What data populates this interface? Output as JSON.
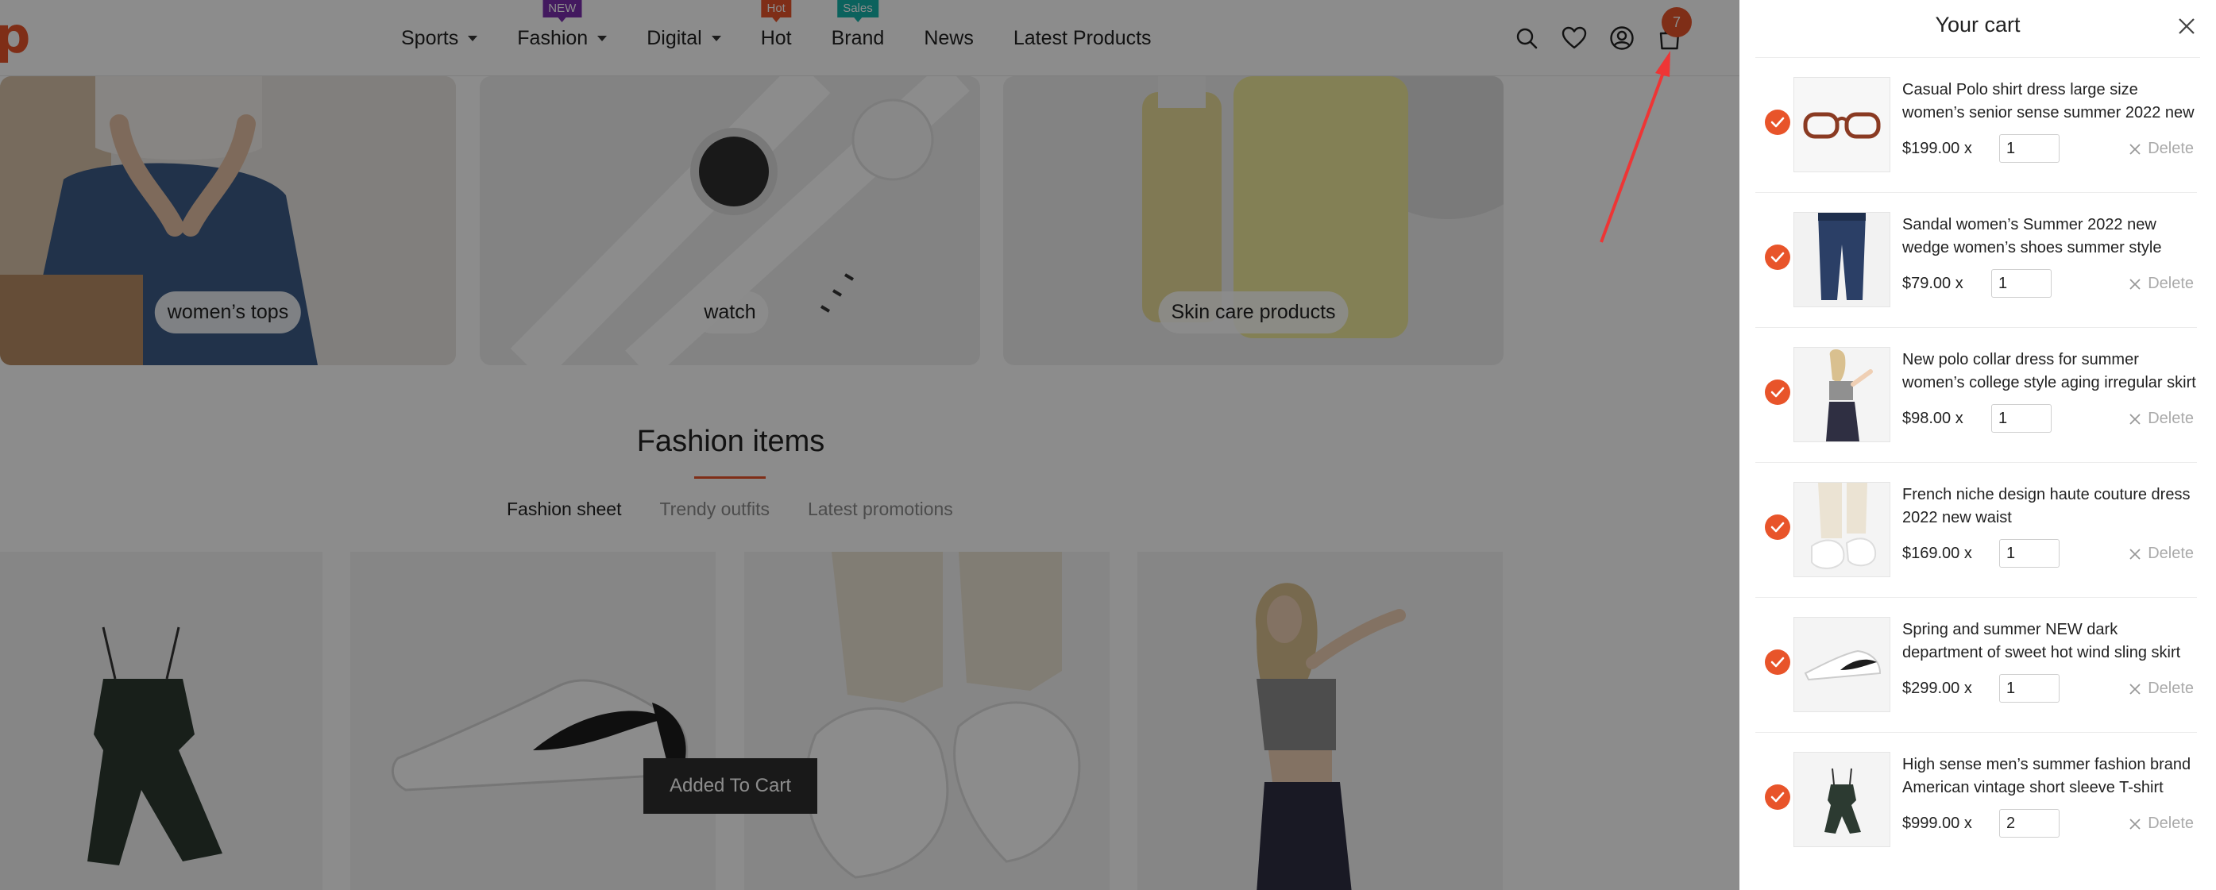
{
  "header": {
    "logo_letter": "p",
    "nav": [
      {
        "label": "Sports",
        "dropdown": true,
        "badge": ""
      },
      {
        "label": "Fashion",
        "dropdown": true,
        "badge": "NEW",
        "badge_color": "#7b2fae"
      },
      {
        "label": "Digital",
        "dropdown": true,
        "badge": ""
      },
      {
        "label": "Hot",
        "dropdown": false,
        "badge": "Hot",
        "badge_color": "#e8542a"
      },
      {
        "label": "Brand",
        "dropdown": false,
        "badge": "Sales",
        "badge_color": "#15b3a9"
      },
      {
        "label": "News",
        "dropdown": false,
        "badge": ""
      },
      {
        "label": "Latest Products",
        "dropdown": false,
        "badge": ""
      }
    ],
    "icons": [
      "search-icon",
      "heart-icon",
      "user-icon",
      "bag-icon"
    ],
    "cart_count": "7"
  },
  "categories": [
    {
      "label": "women’s tops"
    },
    {
      "label": "watch"
    },
    {
      "label": "Skin care products"
    }
  ],
  "section": {
    "title": "Fashion items",
    "tabs": [
      "Fashion sheet",
      "Trendy outfits",
      "Latest promotions"
    ],
    "active_tab": "Fashion sheet"
  },
  "toast": "Added To Cart",
  "cart": {
    "title": "Your cart",
    "delete_label": "Delete",
    "items": [
      {
        "name": "Casual Polo shirt dress large size women’s senior sense summer 2022 new",
        "price": "$199.00",
        "times": "x",
        "qty": "1",
        "thumb": "glasses"
      },
      {
        "name": "Sandal women’s Summer 2022 new wedge women’s shoes summer style",
        "price": "$79.00",
        "times": "x",
        "qty": "1",
        "thumb": "jeans"
      },
      {
        "name": "New polo collar dress for summer women’s college style aging irregular skirt",
        "price": "$98.00",
        "times": "x",
        "qty": "1",
        "thumb": "model"
      },
      {
        "name": "French niche design haute couture dress 2022 new waist",
        "price": "$169.00",
        "times": "x",
        "qty": "1",
        "thumb": "sneakers-beige"
      },
      {
        "name": "Spring and summer NEW dark department of sweet hot wind sling skirt",
        "price": "$299.00",
        "times": "x",
        "qty": "1",
        "thumb": "sneaker-white"
      },
      {
        "name": "High sense men’s summer fashion brand American vintage short sleeve T-shirt",
        "price": "$999.00",
        "times": "x",
        "qty": "2",
        "thumb": "romper"
      }
    ]
  },
  "colors": {
    "accent": "#e8542a",
    "overlay": "rgba(0,0,0,0.45)"
  }
}
